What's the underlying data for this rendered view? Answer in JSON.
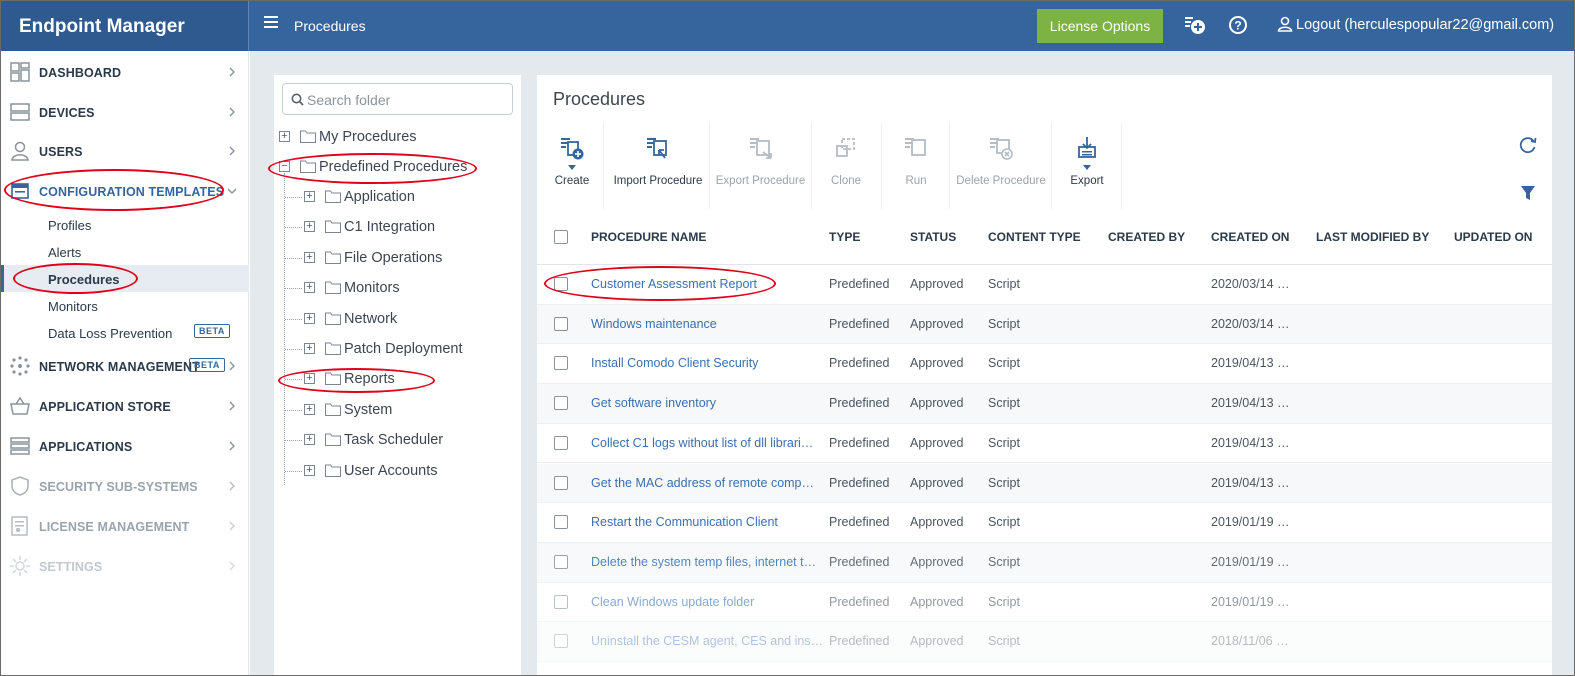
{
  "app": {
    "brand": "Endpoint Manager",
    "breadcrumb": "Procedures",
    "license_button": "License Options",
    "logout_label": "Logout (herculespopular22@gmail.com)"
  },
  "sidebar": {
    "items": [
      {
        "label": "DASHBOARD",
        "icon": "dashboard-icon"
      },
      {
        "label": "DEVICES",
        "icon": "devices-icon"
      },
      {
        "label": "USERS",
        "icon": "user-icon"
      },
      {
        "label": "CONFIGURATION TEMPLATES",
        "icon": "templates-icon"
      },
      {
        "label": "NETWORK MANAGEMENT",
        "icon": "network-icon",
        "badge": "BETA"
      },
      {
        "label": "APPLICATION STORE",
        "icon": "store-icon"
      },
      {
        "label": "APPLICATIONS",
        "icon": "applications-icon"
      },
      {
        "label": "SECURITY SUB-SYSTEMS",
        "icon": "shield-icon"
      },
      {
        "label": "LICENSE MANAGEMENT",
        "icon": "license-icon"
      },
      {
        "label": "SETTINGS",
        "icon": "gear-icon"
      }
    ],
    "sub_items": [
      {
        "label": "Profiles"
      },
      {
        "label": "Alerts"
      },
      {
        "label": "Procedures"
      },
      {
        "label": "Monitors"
      },
      {
        "label": "Data Loss Prevention",
        "badge": "BETA"
      }
    ]
  },
  "folders": {
    "search_placeholder": "Search folder",
    "root": [
      "My Procedures",
      "Predefined Procedures"
    ],
    "children": [
      "Application",
      "C1 Integration",
      "File Operations",
      "Monitors",
      "Network",
      "Patch Deployment",
      "Reports",
      "System",
      "Task Scheduler",
      "User Accounts"
    ]
  },
  "procedures": {
    "title": "Procedures",
    "toolbar": [
      {
        "label": "Create",
        "icon": "create-icon",
        "enabled": true
      },
      {
        "label": "Import Procedure",
        "icon": "import-icon",
        "enabled": true
      },
      {
        "label": "Export Procedure",
        "icon": "export-procedure-icon",
        "enabled": false
      },
      {
        "label": "Clone",
        "icon": "clone-icon",
        "enabled": false
      },
      {
        "label": "Run",
        "icon": "run-icon",
        "enabled": false
      },
      {
        "label": "Delete Procedure",
        "icon": "delete-icon",
        "enabled": false
      },
      {
        "label": "Export",
        "icon": "export-icon",
        "enabled": true
      }
    ],
    "columns": [
      "PROCEDURE NAME",
      "TYPE",
      "STATUS",
      "CONTENT TYPE",
      "CREATED BY",
      "CREATED ON",
      "LAST MODIFIED BY",
      "UPDATED ON"
    ],
    "rows": [
      {
        "name": "Customer Assessment Report",
        "type": "Predefined",
        "status": "Approved",
        "content_type": "Script",
        "created_by": "",
        "created_on": "2020/03/14 …",
        "modified_by": "",
        "updated_on": ""
      },
      {
        "name": "Windows maintenance",
        "type": "Predefined",
        "status": "Approved",
        "content_type": "Script",
        "created_by": "",
        "created_on": "2020/03/14 …",
        "modified_by": "",
        "updated_on": ""
      },
      {
        "name": "Install Comodo Client Security",
        "type": "Predefined",
        "status": "Approved",
        "content_type": "Script",
        "created_by": "",
        "created_on": "2019/04/13 …",
        "modified_by": "",
        "updated_on": ""
      },
      {
        "name": "Get software inventory",
        "type": "Predefined",
        "status": "Approved",
        "content_type": "Script",
        "created_by": "",
        "created_on": "2019/04/13 …",
        "modified_by": "",
        "updated_on": ""
      },
      {
        "name": "Collect C1 logs without list of dll librari…",
        "type": "Predefined",
        "status": "Approved",
        "content_type": "Script",
        "created_by": "",
        "created_on": "2019/04/13 …",
        "modified_by": "",
        "updated_on": ""
      },
      {
        "name": "Get the MAC address of remote comp…",
        "type": "Predefined",
        "status": "Approved",
        "content_type": "Script",
        "created_by": "",
        "created_on": "2019/04/13 …",
        "modified_by": "",
        "updated_on": ""
      },
      {
        "name": "Restart the Communication Client",
        "type": "Predefined",
        "status": "Approved",
        "content_type": "Script",
        "created_by": "",
        "created_on": "2019/01/19 …",
        "modified_by": "",
        "updated_on": ""
      },
      {
        "name": "Delete the system temp files, internet t…",
        "type": "Predefined",
        "status": "Approved",
        "content_type": "Script",
        "created_by": "",
        "created_on": "2019/01/19 …",
        "modified_by": "",
        "updated_on": ""
      },
      {
        "name": "Clean Windows update folder",
        "type": "Predefined",
        "status": "Approved",
        "content_type": "Script",
        "created_by": "",
        "created_on": "2019/01/19 …",
        "modified_by": "",
        "updated_on": ""
      },
      {
        "name": "Uninstall the CESM agent, CES and ins…",
        "type": "Predefined",
        "status": "Approved",
        "content_type": "Script",
        "created_by": "",
        "created_on": "2018/11/06 …",
        "modified_by": "",
        "updated_on": ""
      }
    ]
  },
  "colors": {
    "header": "#36659e",
    "brand_bg": "#2f5a8f",
    "license_button": "#7cb342",
    "link": "#3a6fb0",
    "annotation": "#e0001b"
  }
}
